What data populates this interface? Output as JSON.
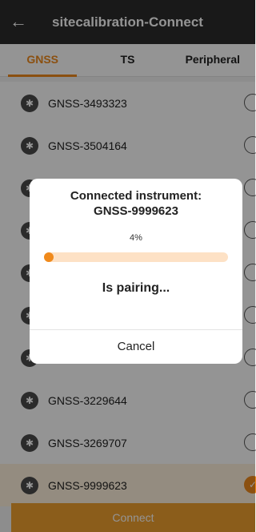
{
  "header": {
    "title": "sitecalibration-Connect"
  },
  "tabs": [
    {
      "label": "GNSS",
      "active": true
    },
    {
      "label": "TS",
      "active": false
    },
    {
      "label": "Peripheral",
      "active": false
    }
  ],
  "devices": [
    {
      "name": "GNSS-3493323",
      "selected": false
    },
    {
      "name": "GNSS-3504164",
      "selected": false
    },
    {
      "name": "",
      "selected": false
    },
    {
      "name": "",
      "selected": false
    },
    {
      "name": "",
      "selected": false
    },
    {
      "name": "",
      "selected": false
    },
    {
      "name": "",
      "selected": false
    },
    {
      "name": "GNSS-3229644",
      "selected": false
    },
    {
      "name": "GNSS-3269707",
      "selected": false
    },
    {
      "name": "GNSS-9999623",
      "selected": true
    }
  ],
  "connect_label": "Connect",
  "dialog": {
    "title_line1": "Connected instrument:",
    "title_line2": "GNSS-9999623",
    "progress_text": "4%",
    "progress_fraction": 0.04,
    "status": "Is pairing...",
    "cancel_label": "Cancel"
  },
  "colors": {
    "accent": "#f08a1c",
    "header_bg": "#2b2b2b"
  },
  "icons": {
    "back": "back-arrow-icon",
    "device": "bluetooth-icon",
    "check": "check-icon"
  }
}
